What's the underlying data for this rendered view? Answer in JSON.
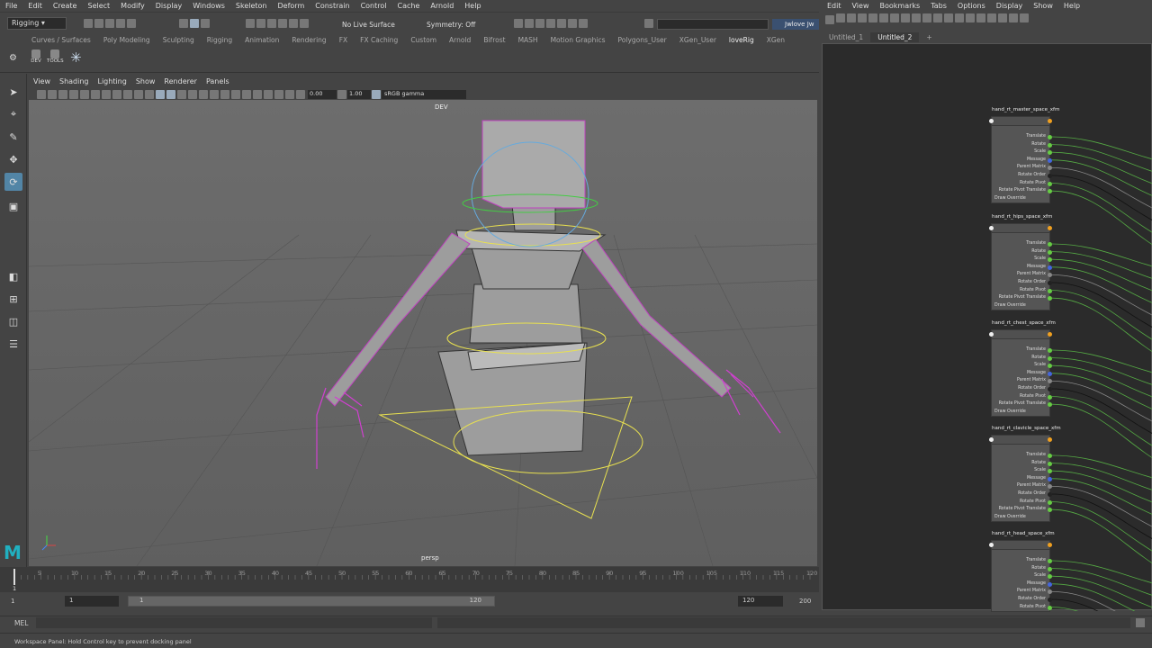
{
  "menubar": [
    "File",
    "Edit",
    "Create",
    "Select",
    "Modify",
    "Display",
    "Windows",
    "Skeleton",
    "Deform",
    "Constrain",
    "Control",
    "Cache",
    "Arnold",
    "Help"
  ],
  "statusline": {
    "menuset": "Rigging",
    "live_surface": "No Live Surface",
    "symmetry": "Symmetry: Off",
    "user": "Jwlove Jw"
  },
  "shelf_tabs": [
    "Curves / Surfaces",
    "Poly Modeling",
    "Sculpting",
    "Rigging",
    "Animation",
    "Rendering",
    "FX",
    "FX Caching",
    "Custom",
    "Arnold",
    "Bifrost",
    "MASH",
    "Motion Graphics",
    "Polygons_User",
    "XGen_User",
    "loveRig",
    "XGen"
  ],
  "shelf_active": "loveRig",
  "shelf_buttons": [
    "DEV",
    "TOOLS"
  ],
  "viewport": {
    "menu": [
      "View",
      "Shading",
      "Lighting",
      "Show",
      "Renderer",
      "Panels"
    ],
    "exposure": "0.00",
    "gamma": "1.00",
    "colorspace": "sRGB gamma",
    "camera_top": "DEV",
    "camera_label": "persp"
  },
  "timeline": {
    "ticks": [
      "5",
      "10",
      "15",
      "20",
      "25",
      "30",
      "35",
      "40",
      "45",
      "50",
      "55",
      "60",
      "65",
      "70",
      "75",
      "80",
      "85",
      "90",
      "95",
      "100",
      "105",
      "110",
      "115",
      "120"
    ],
    "current": "1"
  },
  "range": {
    "start": "1",
    "min": "1",
    "slider_left": "1",
    "slider_right": "120",
    "end": "120",
    "max": "200"
  },
  "cmd": {
    "lang": "MEL"
  },
  "help_text": "Workspace Panel: Hold Control key to prevent docking panel",
  "node_editor": {
    "menubar": [
      "Edit",
      "View",
      "Bookmarks",
      "Tabs",
      "Options",
      "Display",
      "Show",
      "Help"
    ],
    "tabs": [
      "Untitled_1",
      "Untitled_2",
      "+"
    ],
    "active_tab": "Untitled_2",
    "nodes": [
      {
        "title": "hand_rt_master_space_xfm",
        "attrs": [
          "Translate",
          "Rotate",
          "Scale",
          "Message",
          "Parent Matrix",
          "Rotate Order",
          "Rotate Pivot",
          "Rotate Pivot Translate",
          "Draw Override"
        ]
      },
      {
        "title": "hand_rt_hips_space_xfm",
        "attrs": [
          "Translate",
          "Rotate",
          "Scale",
          "Message",
          "Parent Matrix",
          "Rotate Order",
          "Rotate Pivot",
          "Rotate Pivot Translate",
          "Draw Override"
        ]
      },
      {
        "title": "hand_rt_chest_space_xfm",
        "attrs": [
          "Translate",
          "Rotate",
          "Scale",
          "Message",
          "Parent Matrix",
          "Rotate Order",
          "Rotate Pivot",
          "Rotate Pivot Translate",
          "Draw Override"
        ]
      },
      {
        "title": "hand_rt_clavicle_space_xfm",
        "attrs": [
          "Translate",
          "Rotate",
          "Scale",
          "Message",
          "Parent Matrix",
          "Rotate Order",
          "Rotate Pivot",
          "Rotate Pivot Translate",
          "Draw Override"
        ]
      },
      {
        "title": "hand_rt_head_space_xfm",
        "attrs": [
          "Translate",
          "Rotate",
          "Scale",
          "Message",
          "Parent Matrix",
          "Rotate Order",
          "Rotate Pivot"
        ]
      }
    ]
  },
  "colors": {
    "accent": "#5285a6",
    "select": "#e040e0",
    "control": "#e8e050",
    "port_green": "#66cc44",
    "port_orange": "#f0a020"
  }
}
